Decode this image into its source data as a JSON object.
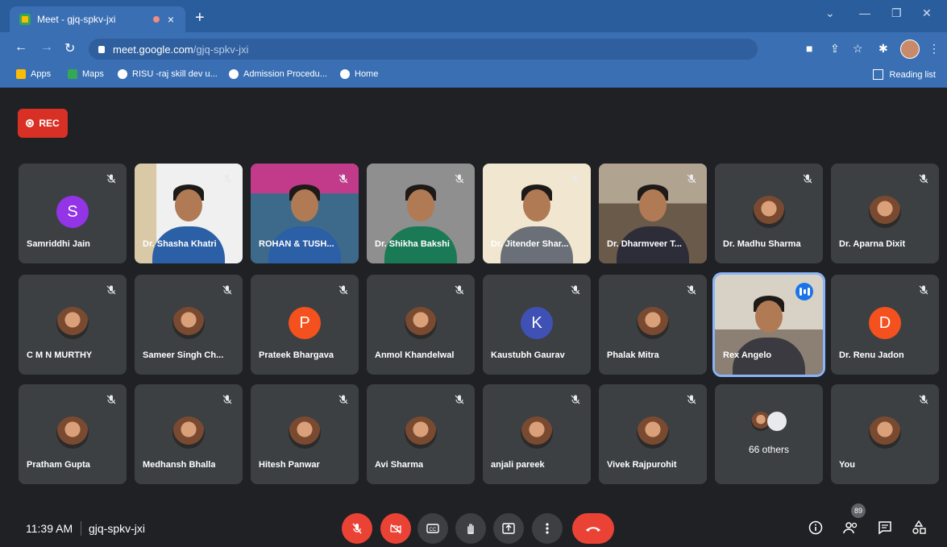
{
  "browser": {
    "tab_title": "Meet - gjq-spkv-jxi",
    "url_host": "meet.google.com",
    "url_path": "/gjq-spkv-jxi",
    "bookmarks": [
      "Apps",
      "Maps",
      "RISU -raj skill dev u...",
      "Admission Procedu...",
      "Home"
    ],
    "reading_list": "Reading list"
  },
  "meet": {
    "rec_label": "REC",
    "time": "11:39 AM",
    "meeting_code": "gjq-spkv-jxi",
    "participants_count": "89",
    "others_label": "66 others",
    "tiles": [
      {
        "name": "Samriddhi Jain",
        "initial": "S",
        "color": "#9334e6"
      },
      {
        "name": "Dr. Shasha Khatri"
      },
      {
        "name": "ROHAN & TUSH..."
      },
      {
        "name": "Dr. Shikha Bakshi"
      },
      {
        "name": "Dr. Jitender Shar..."
      },
      {
        "name": "Dr. Dharmveer T..."
      },
      {
        "name": "Dr. Madhu Sharma"
      },
      {
        "name": "Dr. Aparna Dixit"
      },
      {
        "name": "C M N MURTHY"
      },
      {
        "name": "Sameer Singh Ch..."
      },
      {
        "name": "Prateek Bhargava",
        "initial": "P",
        "color": "#f4511e"
      },
      {
        "name": "Anmol Khandelwal"
      },
      {
        "name": "Kaustubh Gaurav",
        "initial": "K",
        "color": "#3f51b5"
      },
      {
        "name": "Phalak Mitra"
      },
      {
        "name": "Rex Angelo"
      },
      {
        "name": "Dr. Renu Jadon",
        "initial": "D",
        "color": "#f4511e"
      },
      {
        "name": "Pratham Gupta"
      },
      {
        "name": "Medhansh Bhalla"
      },
      {
        "name": "Hitesh Panwar"
      },
      {
        "name": "Avi Sharma"
      },
      {
        "name": "anjali pareek"
      },
      {
        "name": "Vivek Rajpurohit"
      },
      {
        "name": ""
      },
      {
        "name": "You"
      }
    ]
  }
}
